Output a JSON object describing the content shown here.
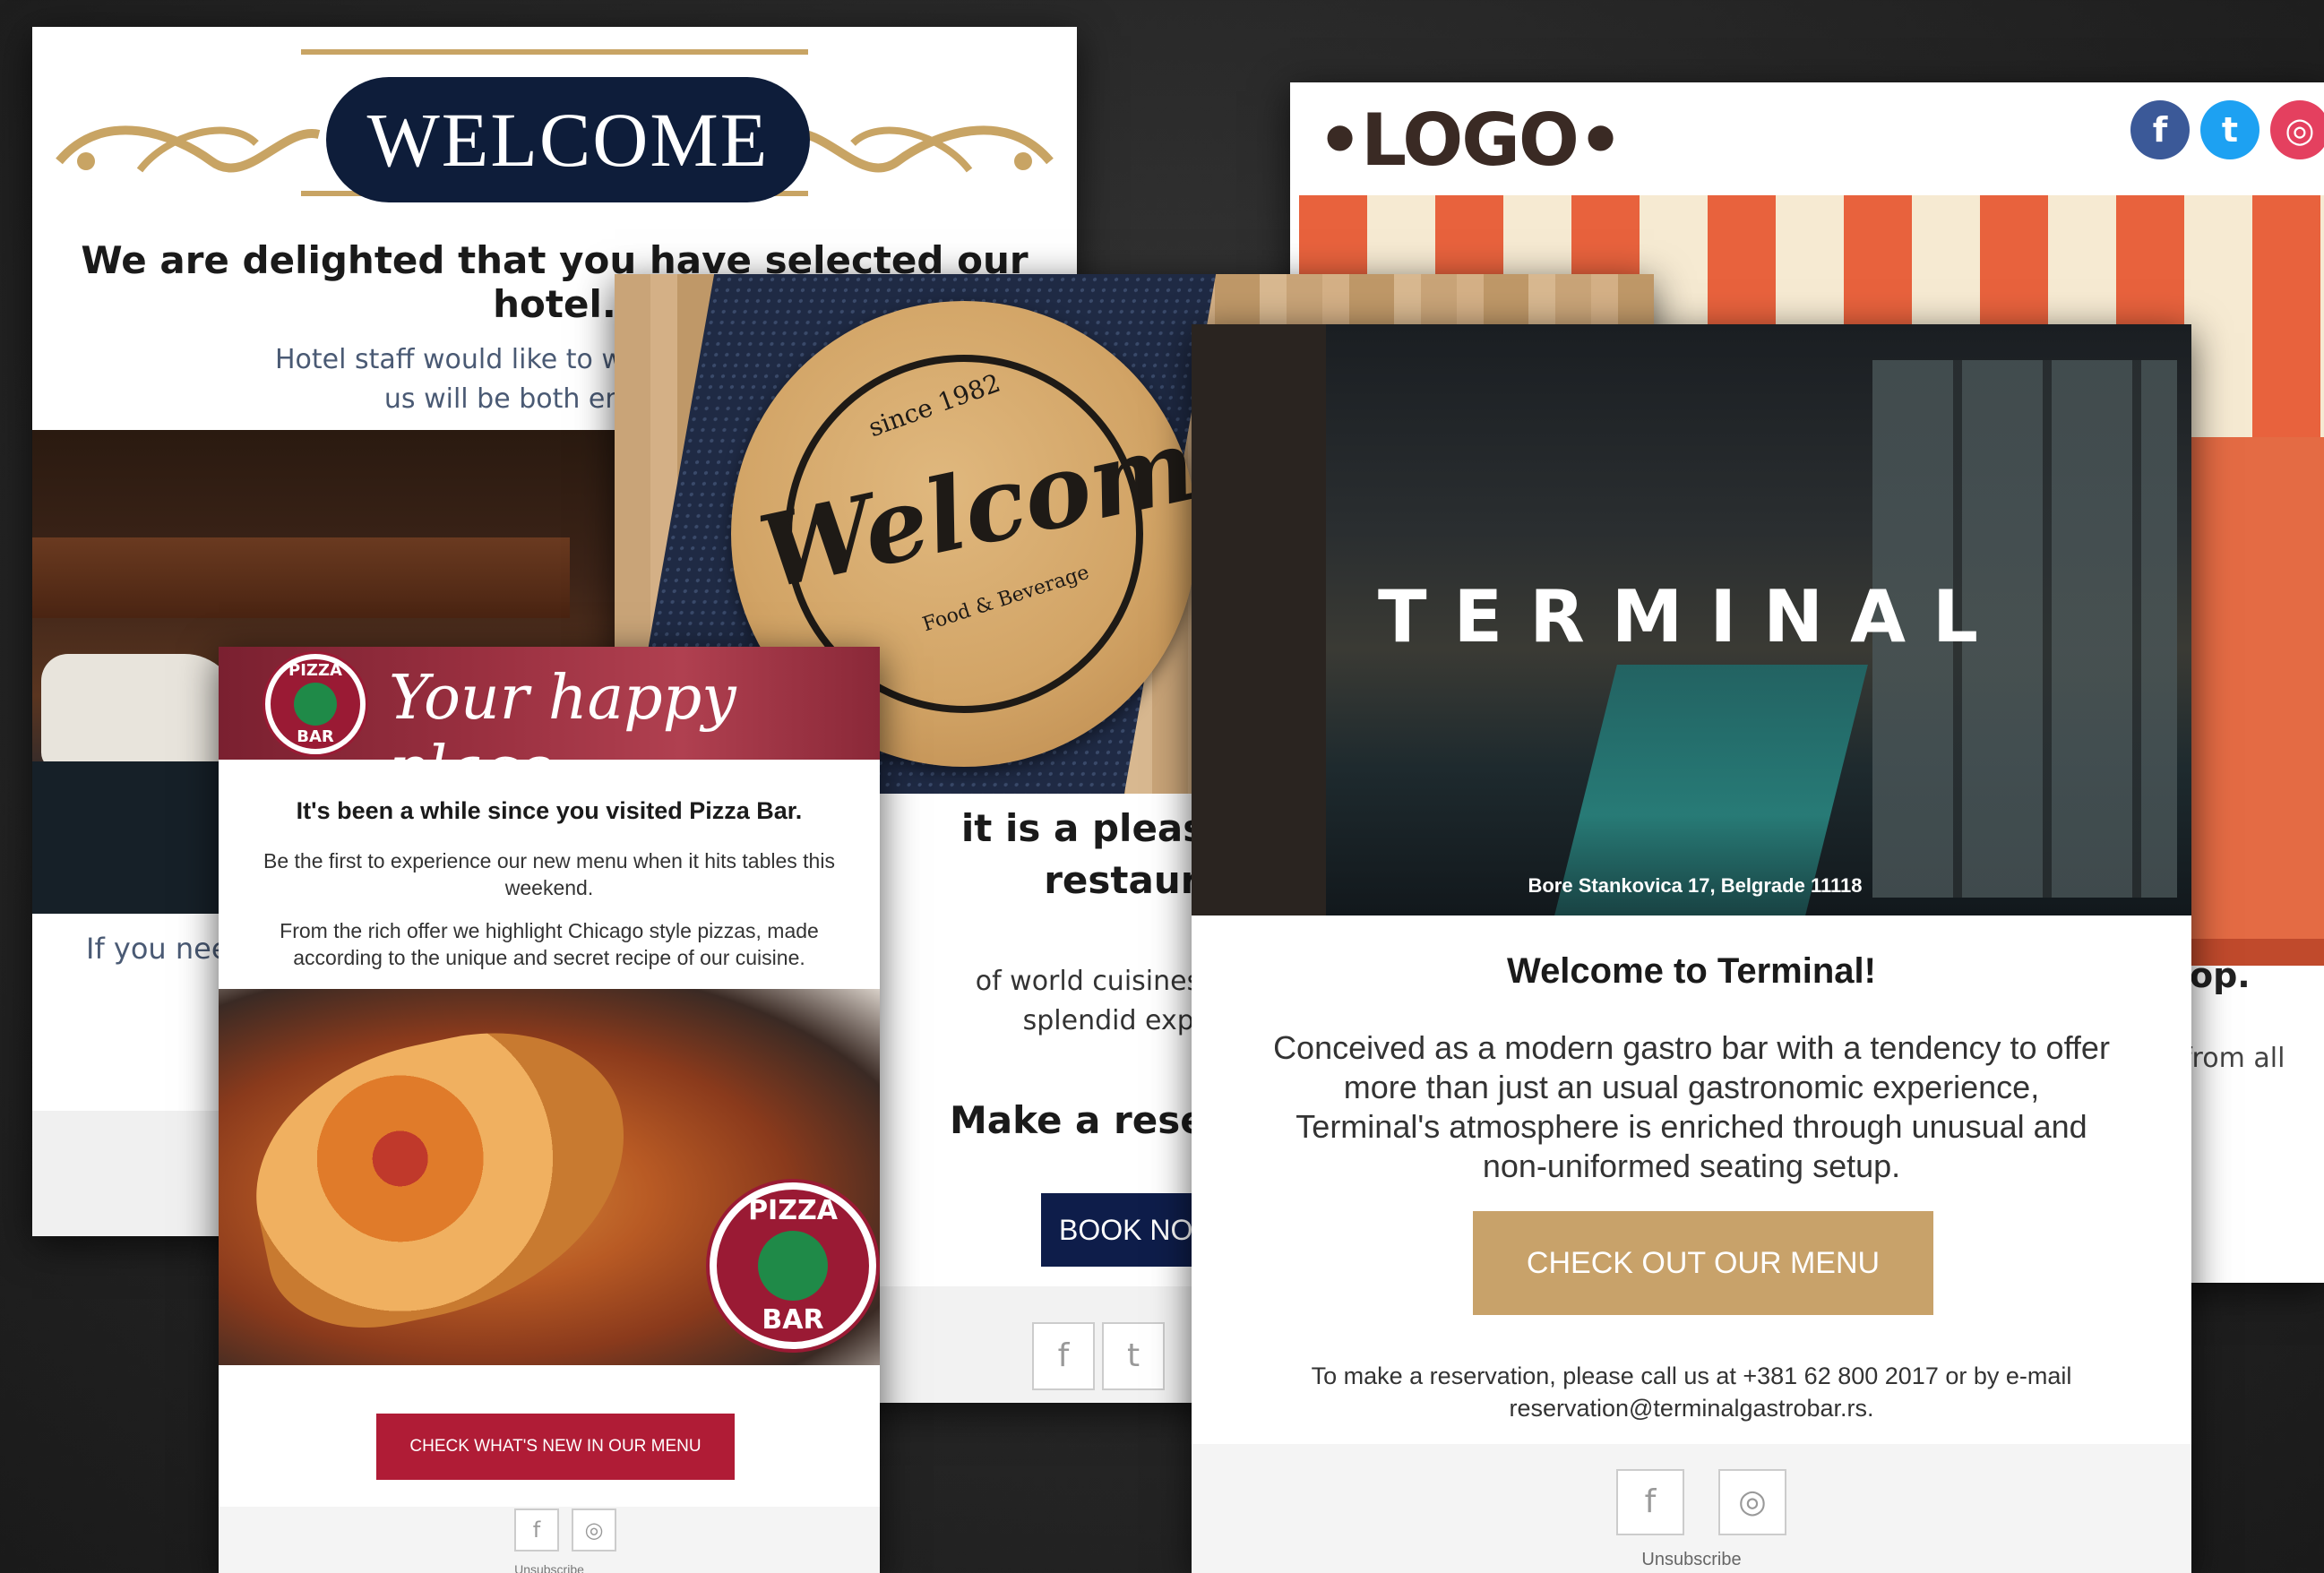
{
  "hotel": {
    "banner": "WELCOME",
    "headline": "We are delighted that you have selected our hotel.",
    "intro_line1": "Hotel staff would like to wish you a warm",
    "intro_line2": "us will be both enjoyable",
    "caption": "If you nee"
  },
  "shop": {
    "logo": "•LOGO•",
    "social": {
      "facebook": "f",
      "twitter": "t",
      "instagram": "◎"
    },
    "partial_heading": "op.",
    "partial_text": "from all",
    "colors": {
      "stripe": "#e8623d",
      "cream": "#f6ead2"
    }
  },
  "restaurant": {
    "board_word": "Welcome",
    "board_since": "since 1982",
    "board_sub": "Food & Beverage",
    "heading_line1": "it is a pleasure t",
    "heading_line2": "restaura",
    "body_line1": "of world cuisines to cho",
    "body_line2": "splendid experie",
    "reserve": "Make a reser",
    "book_button": "BOOK NOV",
    "social": {
      "facebook": "f",
      "twitter": "t"
    }
  },
  "pizza": {
    "badge_top": "PIZZA",
    "badge_bottom": "BAR",
    "tagline": "Your happy place",
    "title": "It's been a while since you visited Pizza Bar.",
    "p1": "Be the first to experience our new menu when it hits tables this weekend.",
    "p2": "From the rich offer we highlight Chicago style pizzas, made according to the unique and secret recipe of our cuisine.",
    "cta": "CHECK WHAT'S NEW IN OUR MENU",
    "social": {
      "facebook": "f",
      "instagram": "◎"
    },
    "unsubscribe": "Unsubscribe",
    "colors": {
      "brand": "#b01c36",
      "green": "#1f8a48"
    }
  },
  "terminal": {
    "brand": "TERMINAL",
    "address": "Bore Stankovica 17, Belgrade 11118",
    "title": "Welcome to Terminal!",
    "body": "Conceived as a modern gastro bar with a tendency to offer more than just an usual gastronomic experience, Terminal's atmosphere is enriched through unusual and non-uniformed seating setup.",
    "cta": "CHECK OUT OUR MENU",
    "contact": "To make a reservation, please call us at +381 62 800 2017 or by e-mail reservation@terminalgastrobar.rs.",
    "social": {
      "facebook": "f",
      "instagram": "◎"
    },
    "unsubscribe": "Unsubscribe",
    "colors": {
      "cta": "#c8a26a"
    }
  }
}
